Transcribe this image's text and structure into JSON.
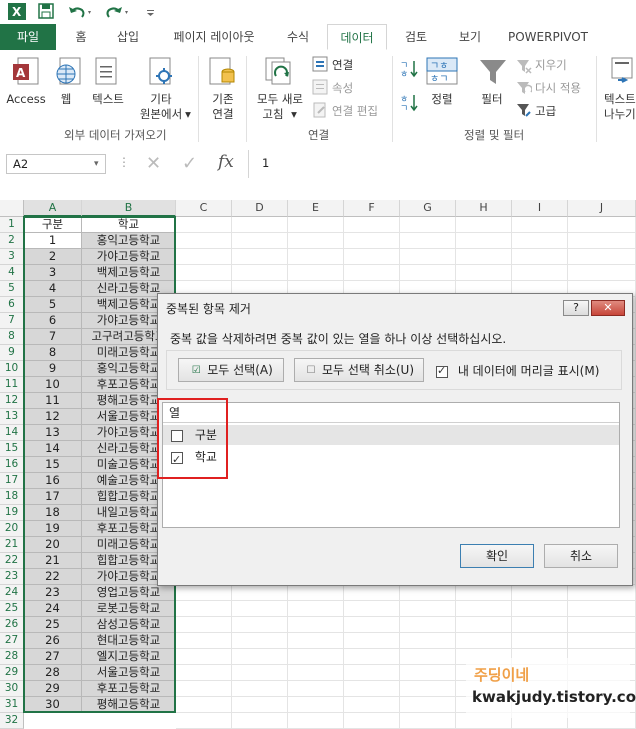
{
  "app": {
    "name": "Excel",
    "quick_access": [
      "excel-logo-icon",
      "save-icon",
      "undo-icon",
      "redo-icon"
    ]
  },
  "tabs": [
    {
      "label": "파일",
      "active": false
    },
    {
      "label": "홈",
      "active": false
    },
    {
      "label": "삽입",
      "active": false
    },
    {
      "label": "페이지 레이아웃",
      "active": false
    },
    {
      "label": "수식",
      "active": false
    },
    {
      "label": "데이터",
      "active": true
    },
    {
      "label": "검토",
      "active": false
    },
    {
      "label": "보기",
      "active": false
    },
    {
      "label": "POWERPIVOT",
      "active": false
    }
  ],
  "ribbon": {
    "external": {
      "access": "Access",
      "web": "웹",
      "text": "텍스트",
      "other_1": "기타",
      "other_2": "원본에서",
      "group": "외부 데이터 가져오기"
    },
    "existing": {
      "line1": "기존",
      "line2": "연결"
    },
    "connections": {
      "refresh_1": "모두 새로",
      "refresh_2": "고침",
      "connections": "연결",
      "properties": "속성",
      "edit_links": "연결 편집",
      "group": "연결"
    },
    "sort_filter": {
      "sort": "정렬",
      "filter": "필터",
      "clear": "지우기",
      "reapply": "다시 적용",
      "advanced": "고급",
      "group": "정렬 및 필터"
    },
    "text_to_columns": {
      "line1": "텍스트",
      "line2": "나누기"
    }
  },
  "formula_bar": {
    "name_box": "A2",
    "value": "1",
    "cancel": "✕",
    "enter": "✓",
    "fx": "fx"
  },
  "sheet": {
    "columns": [
      "A",
      "B",
      "C",
      "D",
      "E",
      "F",
      "G",
      "H",
      "I",
      "J"
    ],
    "header_row": [
      "구분",
      "학교"
    ],
    "rows": [
      [
        "1",
        "홍익고등학교"
      ],
      [
        "2",
        "가야고등학교"
      ],
      [
        "3",
        "백제고등학교"
      ],
      [
        "4",
        "신라고등학교"
      ],
      [
        "5",
        "백제고등학교"
      ],
      [
        "6",
        "가야고등학교"
      ],
      [
        "7",
        "고구려고등학교"
      ],
      [
        "8",
        "미래고등학교"
      ],
      [
        "9",
        "홍익고등학교"
      ],
      [
        "10",
        "후포고등학교"
      ],
      [
        "11",
        "평해고등학교"
      ],
      [
        "12",
        "서울고등학교"
      ],
      [
        "13",
        "가야고등학교"
      ],
      [
        "14",
        "신라고등학교"
      ],
      [
        "15",
        "미술고등학교"
      ],
      [
        "16",
        "예술고등학교"
      ],
      [
        "17",
        "힙합고등학교"
      ],
      [
        "18",
        "내일고등학교"
      ],
      [
        "19",
        "후포고등학교"
      ],
      [
        "20",
        "미래고등학교"
      ],
      [
        "21",
        "힙합고등학교"
      ],
      [
        "22",
        "가야고등학교"
      ],
      [
        "23",
        "영업고등학교"
      ],
      [
        "24",
        "로봇고등학교"
      ],
      [
        "25",
        "삼성고등학교"
      ],
      [
        "26",
        "현대고등학교"
      ],
      [
        "27",
        "엘지고등학교"
      ],
      [
        "28",
        "서울고등학교"
      ],
      [
        "29",
        "후포고등학교"
      ],
      [
        "30",
        "평해고등학교"
      ]
    ],
    "row_numbers": [
      "1",
      "2",
      "3",
      "4",
      "5",
      "6",
      "7",
      "8",
      "9",
      "10",
      "11",
      "12",
      "13",
      "14",
      "15",
      "16",
      "17",
      "18",
      "19",
      "20",
      "21",
      "22",
      "23",
      "24",
      "25",
      "26",
      "27",
      "28",
      "29",
      "30",
      "31",
      "32"
    ]
  },
  "dialog": {
    "title": "중복된 항목 제거",
    "help": "?",
    "close": "✕",
    "instruction": "중복 값을 삭제하려면 중복 값이 있는 열을 하나 이상 선택하십시오.",
    "select_all": "모두 선택(A)",
    "unselect_all": "모두 선택 취소(U)",
    "has_headers_label": "내 데이터에 머리글 표시(M)",
    "has_headers_checked": true,
    "list_header": "열",
    "columns": [
      {
        "label": "구분",
        "checked": false
      },
      {
        "label": "학교",
        "checked": true
      }
    ],
    "ok": "확인",
    "cancel": "취소"
  },
  "watermark": {
    "title": "주딩이네",
    "url": "kwakjudy.tistory.com"
  },
  "colors": {
    "excel_green": "#217346",
    "selection_gray": "#d7d7d7",
    "highlight_red": "#e02020"
  }
}
